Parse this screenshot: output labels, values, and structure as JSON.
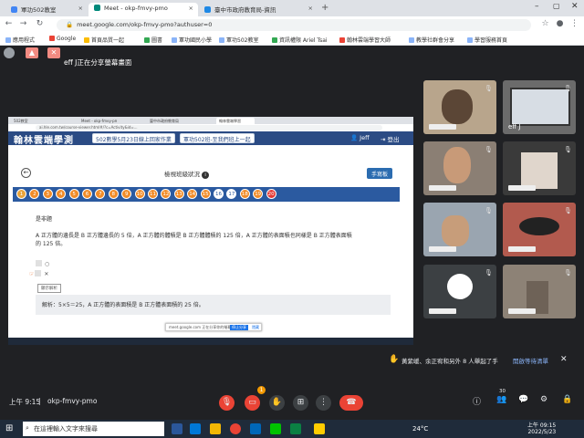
{
  "browser": {
    "tabs": [
      {
        "label": "軍功502教室",
        "color": "#4285f4"
      },
      {
        "label": "Meet - okp-fmvy-pmo",
        "color": "#00897b"
      },
      {
        "label": "臺中市政府教育局-資訊",
        "color": "#1e88e5"
      }
    ],
    "url": "meet.google.com/okp-fmvy-pmo?authuser=0",
    "bookmarks": [
      "應用程式",
      "Google",
      "首頁品質一起",
      "圖書",
      "軍功國民小學",
      "軍功502教室",
      "資訊權限 Ariel Tsai",
      "翰林雲端學習大師",
      "教學社群會分享",
      "學習服務首頁"
    ]
  },
  "meet": {
    "presenter_label": "eff J正在分享螢幕畫面",
    "clock": "上午 9:15",
    "meeting_code": "okp-fmvy-pmo",
    "notification": "黃紫嵈、余正宥和另外 8 人舉起了手",
    "notification_action": "開啟等待清單",
    "participant_count": "30",
    "hand_badge": "1",
    "tile_label_jeff": "eff J"
  },
  "shared": {
    "tabs": [
      "502教室",
      "Meet - okp-fmvy-pmo",
      "臺中市政府教育局",
      "翰林雲端學習"
    ],
    "url": "ai.hle.com.tw/course-viewer.html#/?c=Activity&id=...",
    "logo": "翰林雲端學測",
    "header_btn1": "502數學5月23日線上回家作業",
    "header_btn2": "軍功502班-至我們班上一起",
    "user": "Jeff",
    "logout": "登出",
    "page_title": "檢視班級狀況",
    "hand_in": "手寫板",
    "questions": [
      "1",
      "2",
      "3",
      "4",
      "5",
      "6",
      "7",
      "8",
      "9",
      "10",
      "11",
      "12",
      "13",
      "14",
      "15",
      "16",
      "17",
      "18",
      "19",
      "20"
    ],
    "q_label": "是非題",
    "q_text_1": "A 正方體的邊長是 B 正方體邊長的 5 倍，A 正方體的體積是 B 正方體體積的 125 倍，A 正方體的表面積也同樣是 B 正方體表面積",
    "q_text_2": "的 125 倍。",
    "opt_o": "○",
    "opt_x": "✕",
    "show_answer": "顯示解析",
    "explanation": "解析：5×5＝25，A 正方體的表面積是 B 正方體表面積的 25 倍。",
    "share_note": "meet.google.com 正在分享你的螢幕畫面",
    "stop_share": "停止分享",
    "hide": "隱藏"
  },
  "taskbar": {
    "search_placeholder": "在這裡輸入文字來搜尋",
    "weather": "24°C",
    "time": "上午 09:15",
    "date": "2022/5/23"
  }
}
